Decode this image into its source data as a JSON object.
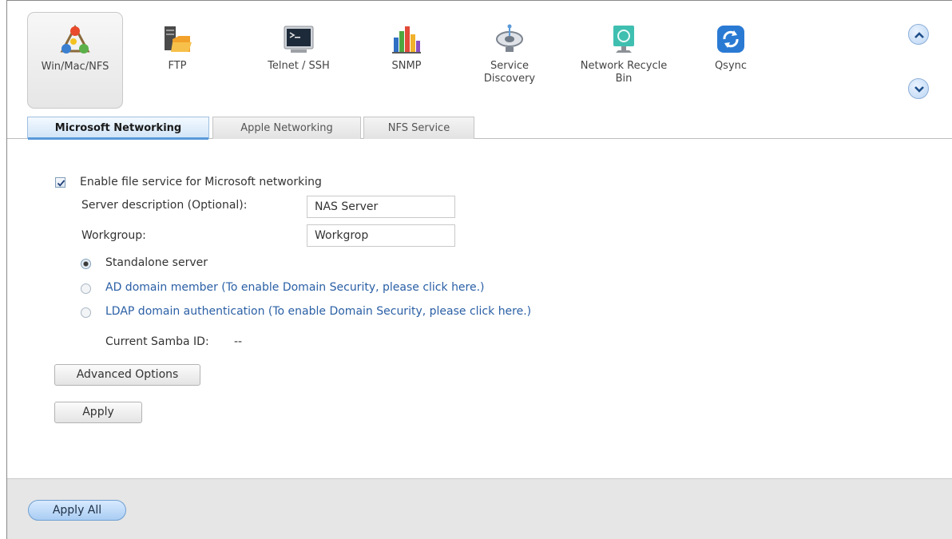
{
  "toolbar": {
    "services": [
      {
        "label": "Win/Mac/NFS",
        "icon": "win-mac-nfs-icon"
      },
      {
        "label": "FTP",
        "icon": "ftp-folder-icon"
      },
      {
        "label": "Telnet / SSH",
        "icon": "terminal-icon"
      },
      {
        "label": "SNMP",
        "icon": "bar-chart-icon"
      },
      {
        "label": "Service Discovery",
        "icon": "satellite-dish-icon"
      },
      {
        "label": "Network Recycle Bin",
        "icon": "recycle-bin-icon"
      },
      {
        "label": "Qsync",
        "icon": "sync-icon"
      }
    ],
    "scroll_up_icon": "chevron-up-icon",
    "scroll_down_icon": "chevron-down-icon"
  },
  "tabs": [
    {
      "label": "Microsoft Networking",
      "active": true
    },
    {
      "label": "Apple Networking",
      "active": false
    },
    {
      "label": "NFS Service",
      "active": false
    }
  ],
  "form": {
    "enable_label": "Enable file service for Microsoft networking",
    "enable_checked": true,
    "server_description_label": "Server description (Optional):",
    "server_description_value": "NAS Server",
    "workgroup_label": "Workgroup:",
    "workgroup_value": "Workgrop",
    "radio_standalone": "Standalone server",
    "radio_ad": "AD domain member (To enable Domain Security, please click here.)",
    "radio_ldap": "LDAP domain authentication (To enable Domain Security, please click here.)",
    "selected_mode": "Standalone server",
    "samba_id_label": "Current Samba ID:",
    "samba_id_value": "--",
    "advanced_button": "Advanced Options",
    "apply_button": "Apply"
  },
  "footer": {
    "apply_all_button": "Apply All"
  },
  "colors": {
    "accent": "#5a9ad9",
    "link": "#2a5fa5",
    "footer_bg": "#e6e6e6"
  }
}
